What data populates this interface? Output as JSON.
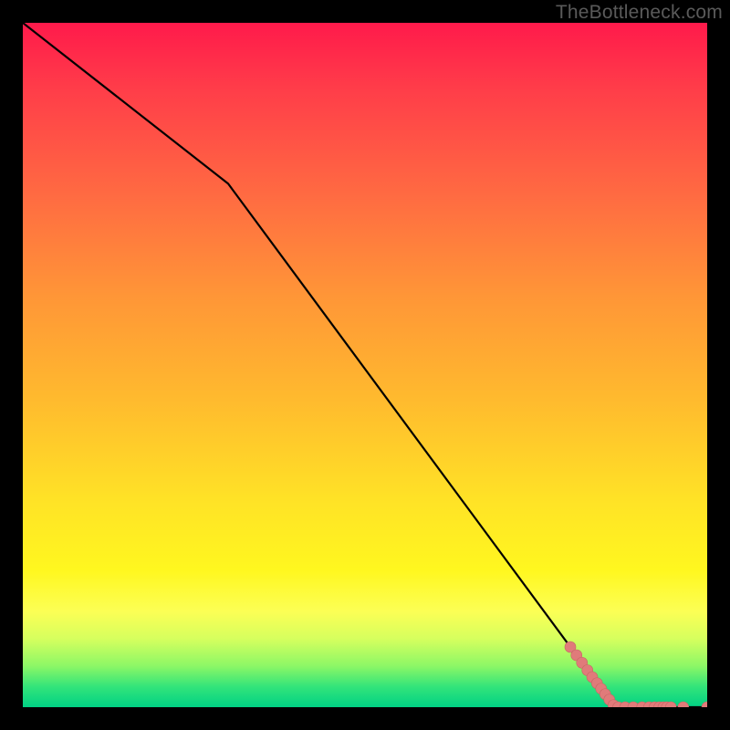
{
  "watermark": "TheBottleneck.com",
  "colors": {
    "page_bg": "#000000",
    "line": "#000000",
    "marker_fill": "#e07b7a",
    "marker_stroke": "#c76664",
    "gradient_top": "#ff1a4b",
    "gradient_bottom": "#00d184",
    "watermark": "#5a5a5a"
  },
  "chart_data": {
    "type": "line",
    "title": "",
    "xlabel": "",
    "ylabel": "",
    "xlim": [
      0,
      100
    ],
    "ylim": [
      0,
      100
    ],
    "grid": false,
    "legend": false,
    "series": [
      {
        "name": "curve",
        "kind": "line",
        "x": [
          0,
          30,
          86.5,
          100
        ],
        "y": [
          100,
          76.5,
          0,
          0
        ]
      },
      {
        "name": "markers-descending",
        "kind": "scatter",
        "x": [
          80.0,
          80.9,
          81.7,
          82.5,
          83.2,
          83.9,
          84.5,
          85.1,
          85.7,
          86.3
        ],
        "y": [
          8.8,
          7.6,
          6.5,
          5.4,
          4.4,
          3.5,
          2.7,
          1.9,
          1.1,
          0.3
        ]
      },
      {
        "name": "markers-baseline",
        "kind": "scatter",
        "x": [
          87.0,
          88.0,
          89.2,
          90.5,
          91.5,
          92.3,
          93.0,
          93.6,
          94.1,
          94.7,
          96.5,
          100.0
        ],
        "y": [
          0.0,
          0.0,
          0.0,
          0.0,
          0.0,
          0.0,
          0.0,
          0.0,
          0.0,
          0.0,
          0.0,
          0.0
        ]
      }
    ]
  }
}
